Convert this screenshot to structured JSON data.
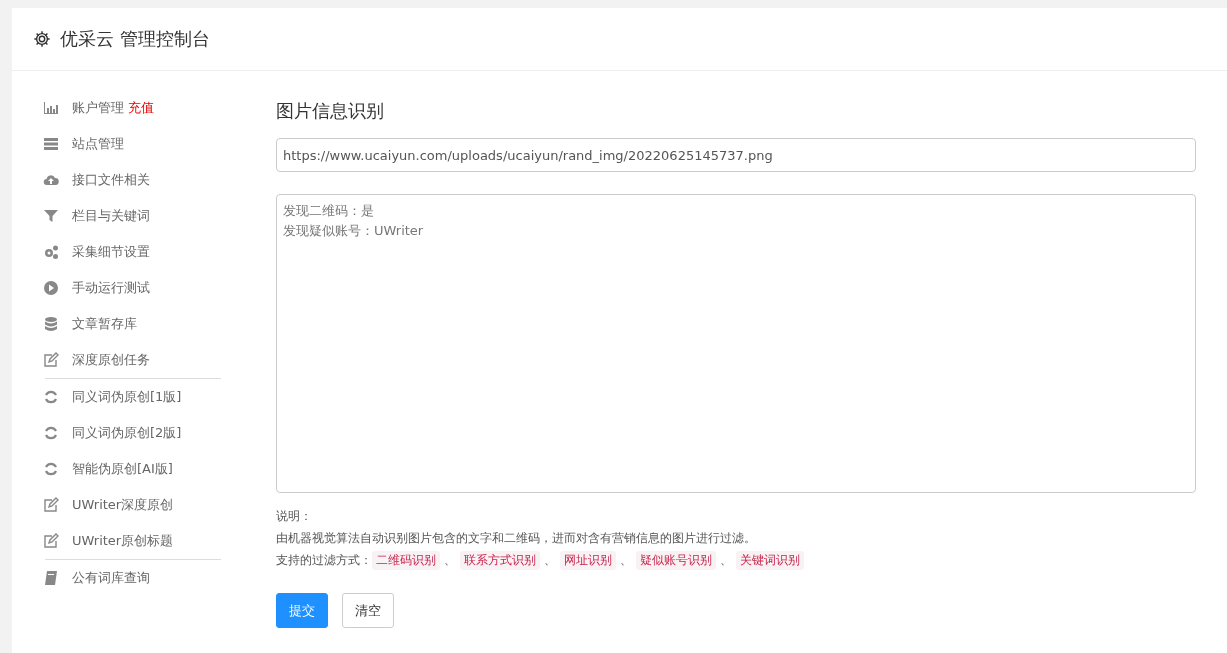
{
  "header": {
    "title": "优采云 管理控制台"
  },
  "sidebar": {
    "groups": [
      [
        {
          "label": "账户管理",
          "badge": "充值",
          "kind": "chart"
        },
        {
          "label": "站点管理",
          "kind": "server"
        },
        {
          "label": "接口文件相关",
          "kind": "cloud"
        },
        {
          "label": "栏目与关键词",
          "kind": "filter"
        },
        {
          "label": "采集细节设置",
          "kind": "gears"
        },
        {
          "label": "手动运行测试",
          "kind": "play"
        },
        {
          "label": "文章暂存库",
          "kind": "database"
        },
        {
          "label": "深度原创任务",
          "kind": "edit"
        }
      ],
      [
        {
          "label": "同义词伪原创[1版]",
          "kind": "refresh"
        },
        {
          "label": "同义词伪原创[2版]",
          "kind": "refresh"
        },
        {
          "label": "智能伪原创[AI版]",
          "kind": "refresh"
        },
        {
          "label": "UWriter深度原创",
          "kind": "edit"
        },
        {
          "label": "UWriter原创标题",
          "kind": "edit"
        }
      ],
      [
        {
          "label": "公有词库查询",
          "kind": "book"
        }
      ]
    ]
  },
  "main": {
    "title": "图片信息识别",
    "url_field": {
      "value": "https://www.ucaiyun.com/uploads/ucaiyun/rand_img/20220625145737.png"
    },
    "result_field": {
      "lines": [
        "发现二维码：是",
        "发现疑似账号：UWriter"
      ]
    },
    "note_label": "说明：",
    "note_text": "由机器视觉算法自动识别图片包含的文字和二维码，进而对含有营销信息的图片进行过滤。",
    "filters_label": "支持的过滤方式：",
    "separator": "、",
    "filters": [
      "二维码识别",
      "联系方式识别",
      "网址识别",
      "疑似账号识别",
      "关键词识别"
    ],
    "buttons": [
      {
        "label": "提交",
        "kind": "primary"
      },
      {
        "label": "清空",
        "kind": "default"
      }
    ]
  }
}
